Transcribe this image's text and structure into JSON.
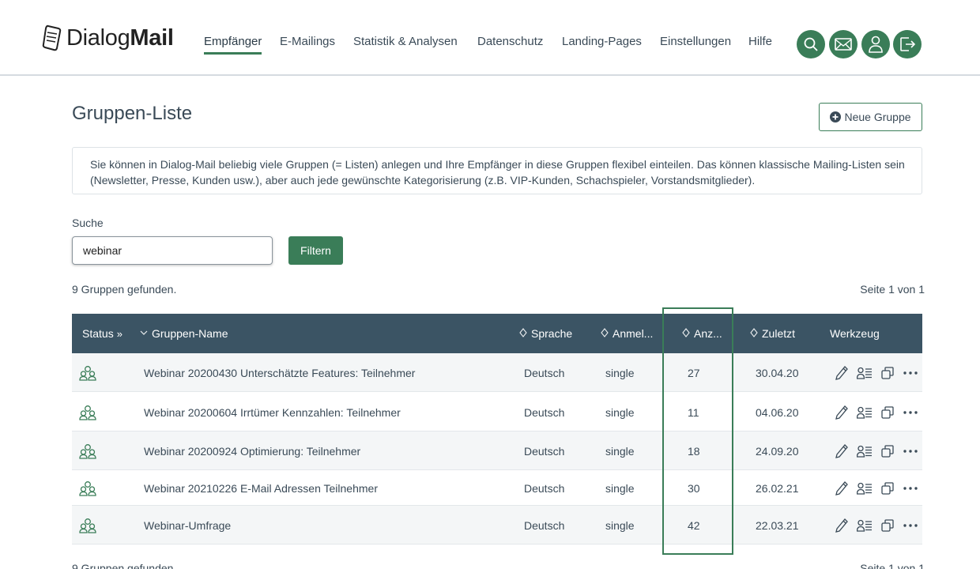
{
  "brand": {
    "name_light": "Dialog",
    "name_bold": "Mail"
  },
  "nav": {
    "items": [
      {
        "label": "Empfänger",
        "active": true
      },
      {
        "label": "E-Mailings"
      },
      {
        "label": "Statistik & Analysen"
      },
      {
        "label": "Datenschutz"
      },
      {
        "label": "Landing-Pages"
      },
      {
        "label": "Einstellungen"
      },
      {
        "label": "Hilfe"
      }
    ],
    "icons": [
      "search-icon",
      "mail-icon",
      "user-icon",
      "logout-icon"
    ]
  },
  "page": {
    "title": "Gruppen-Liste",
    "new_group_label": "Neue Gruppe",
    "info_text": "Sie können in Dialog-Mail beliebig viele Gruppen (= Listen) anlegen und Ihre Empfänger in diese Gruppen flexibel einteilen. Das können klassische Mailing-Listen sein (Newsletter, Presse, Kunden usw.), aber auch jede gewünschte Kategorisierung (z.B. VIP-Kunden, Schachspieler, Vorstandsmitglieder)."
  },
  "search": {
    "label": "Suche",
    "value": "webinar",
    "button": "Filtern"
  },
  "results": {
    "found_text": "9 Gruppen gefunden.",
    "page_text": "Seite 1 von 1"
  },
  "table": {
    "columns": {
      "status": "Status",
      "name": "Gruppen-Name",
      "language": "Sprache",
      "signup": "Anmel...",
      "count": "Anz...",
      "last": "Zuletzt",
      "tools": "Werkzeug"
    },
    "rows": [
      {
        "name": "Webinar 20200430 Unterschätzte Features: Teilnehmer",
        "language": "Deutsch",
        "signup": "single",
        "count": "27",
        "last": "30.04.20"
      },
      {
        "name": "Webinar 20200604 Irrtümer Kennzahlen: Teilnehmer",
        "language": "Deutsch",
        "signup": "single",
        "count": "11",
        "last": "04.06.20"
      },
      {
        "name": "Webinar 20200924 Optimierung: Teilnehmer",
        "language": "Deutsch",
        "signup": "single",
        "count": "18",
        "last": "24.09.20"
      },
      {
        "name": "Webinar 20210226 E-Mail Adressen Teilnehmer",
        "language": "Deutsch",
        "signup": "single",
        "count": "30",
        "last": "26.02.21"
      },
      {
        "name": "Webinar-Umfrage",
        "language": "Deutsch",
        "signup": "single",
        "count": "42",
        "last": "22.03.21"
      }
    ],
    "row_tools": [
      "edit-icon",
      "recipients-icon",
      "copy-icon",
      "more-icon"
    ]
  },
  "colors": {
    "accent": "#3a7d58",
    "header_bg": "#3b5464",
    "text": "#3a4a57"
  }
}
